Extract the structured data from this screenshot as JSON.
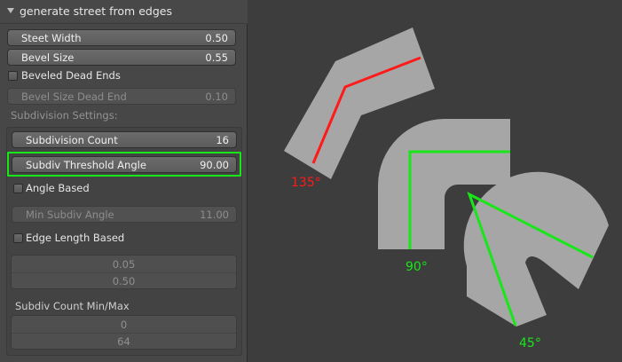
{
  "panel": {
    "title": "generate street from edges",
    "street_width": {
      "label": "Steet Width",
      "value": "0.50"
    },
    "bevel_size": {
      "label": "Bevel Size",
      "value": "0.55"
    },
    "beveled_dead_ends": {
      "label": "Beveled Dead Ends",
      "checked": false
    },
    "bevel_size_dead_end": {
      "label": "Bevel Size Dead End",
      "value": "0.10"
    },
    "subdivision_settings_label": "Subdivision Settings:",
    "subdivision_count": {
      "label": "Subdivision Count",
      "value": "16"
    },
    "subdiv_threshold_angle": {
      "label": "Subdiv Threshold Angle",
      "value": "90.00"
    },
    "angle_based": {
      "label": "Angle Based",
      "checked": false
    },
    "min_subdiv_angle": {
      "label": "Min Subdiv Angle",
      "value": "11.00"
    },
    "edge_length_based": {
      "label": "Edge Length Based",
      "checked": false
    },
    "edge_length_values": [
      "0.05",
      "0.50"
    ],
    "subdiv_count_minmax_label": "Subdiv Count Min/Max",
    "subdiv_count_values": [
      "0",
      "64"
    ]
  },
  "diagram": {
    "labels": {
      "a135": "135°",
      "a90": "90°",
      "a45": "45°"
    },
    "colors": {
      "red": "#ff1a1a",
      "green": "#19e619",
      "shape": "#a6a6a6",
      "background": "#3d3d3d",
      "highlight": "#19e619"
    }
  }
}
